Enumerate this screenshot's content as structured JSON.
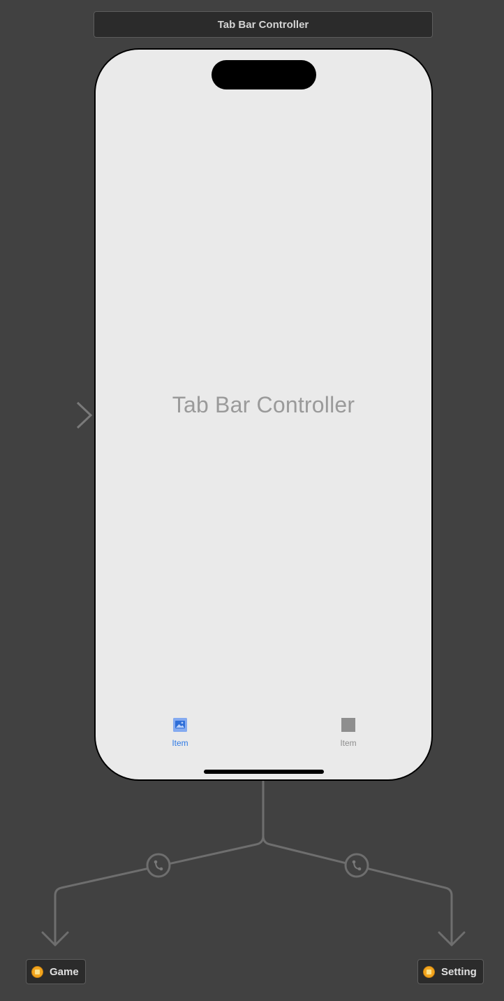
{
  "storyboard": {
    "scene_title": "Tab Bar Controller",
    "placeholder_title": "Tab Bar Controller",
    "tab_bar": {
      "items": [
        {
          "label": "Item",
          "icon": "photo-icon",
          "state": "selected",
          "color": "#2f7ae5"
        },
        {
          "label": "Item",
          "icon": "square-icon",
          "state": "unselected",
          "color": "#8e8e8e"
        }
      ]
    },
    "destinations": [
      {
        "label": "Game",
        "icon": "view-controller-icon"
      },
      {
        "label": "Setting",
        "icon": "view-controller-icon"
      }
    ],
    "colors": {
      "canvas": "#414141",
      "scene_background": "#eaeaea",
      "connector": "#6e6e6e",
      "view_controller_icon": "#f2a51e"
    }
  }
}
